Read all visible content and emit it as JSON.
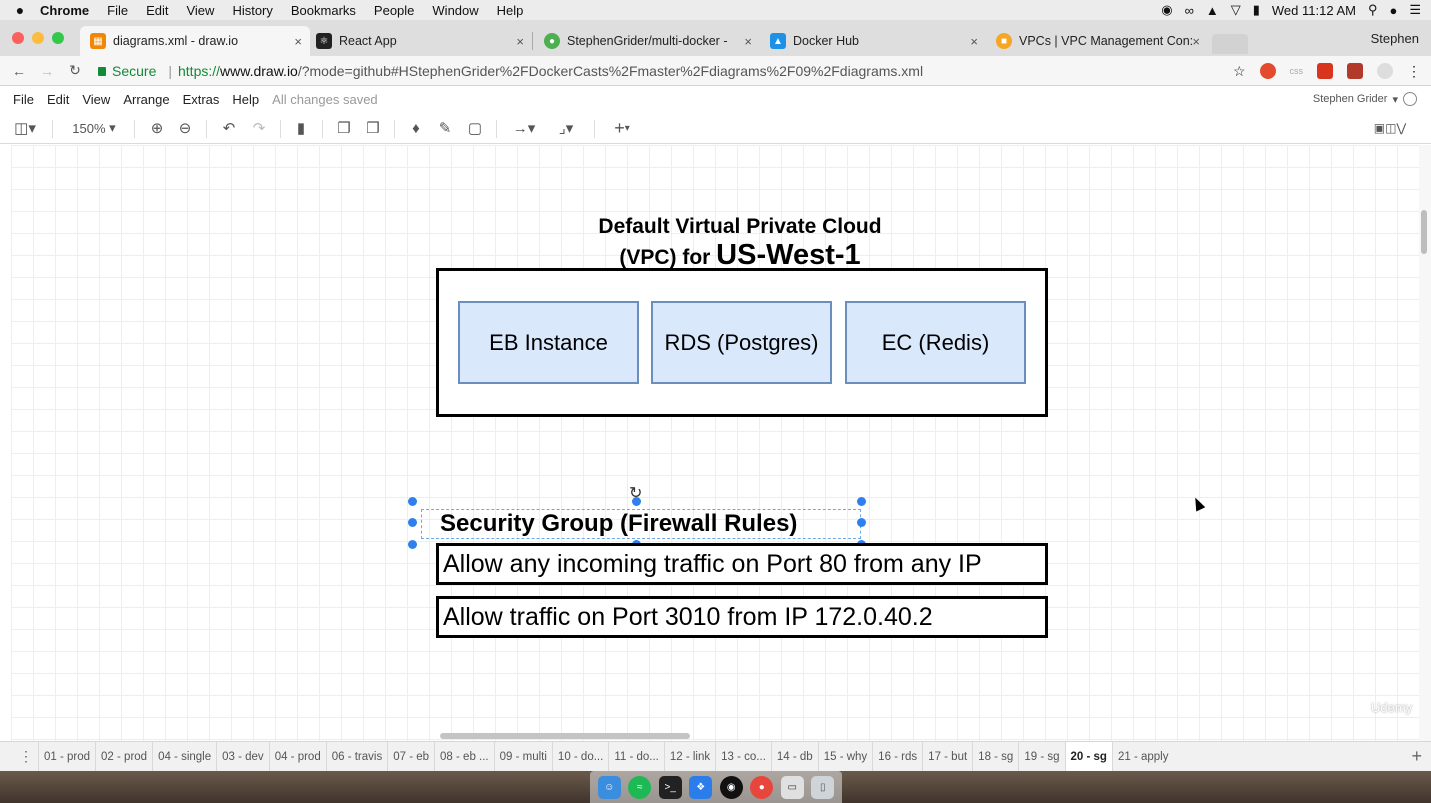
{
  "macos_menu": {
    "apple": "",
    "items": [
      "Chrome",
      "File",
      "Edit",
      "View",
      "History",
      "Bookmarks",
      "People",
      "Window",
      "Help"
    ],
    "clock": "Wed 11:12 AM"
  },
  "browser": {
    "tabs": [
      {
        "title": "diagrams.xml - draw.io",
        "active": true,
        "favicon_color": "#f08705"
      },
      {
        "title": "React App",
        "active": false,
        "favicon_color": "#222222"
      },
      {
        "title": "StephenGrider/multi-docker -",
        "active": false,
        "favicon_color": "#4caf50"
      },
      {
        "title": "Docker Hub",
        "active": false,
        "favicon_color": "#1d91e6"
      },
      {
        "title": "VPCs | VPC Management Con:",
        "active": false,
        "favicon_color": "#f5a623"
      }
    ],
    "profile": "Stephen",
    "address": {
      "secure_label": "Secure",
      "scheme": "https://",
      "host": "www.draw.io",
      "path": "/?mode=github#HStephenGrider%2FDockerCasts%2Fmaster%2Fdiagrams%2F09%2Fdiagrams.xml"
    },
    "extension_label": "css"
  },
  "drawio": {
    "menu": [
      "File",
      "Edit",
      "View",
      "Arrange",
      "Extras",
      "Help"
    ],
    "save_status": "All changes saved",
    "user": "Stephen Grider",
    "zoom": "150%"
  },
  "diagram": {
    "vpc_title_line1": "Default Virtual Private Cloud",
    "vpc_title_line2_prefix": "(VPC) for",
    "vpc_title_region": "US-West-1",
    "services": [
      "EB Instance",
      "RDS (Postgres)",
      "EC (Redis)"
    ],
    "security_group_title": "Security Group (Firewall Rules)",
    "rules": [
      "Allow any incoming traffic on Port 80 from any IP",
      "Allow traffic on Port 3010 from IP 172.0.40.2"
    ],
    "fill_color": "#dae8fc",
    "stroke_color": "#6c8ebf",
    "selection_color": "#2f80ed"
  },
  "watermark": "Udemy",
  "pages": [
    {
      "label": "01 - prod",
      "active": false
    },
    {
      "label": "02 - prod",
      "active": false
    },
    {
      "label": "04 - single",
      "active": false
    },
    {
      "label": "03 - dev",
      "active": false
    },
    {
      "label": "04 - prod",
      "active": false
    },
    {
      "label": "06 - travis",
      "active": false
    },
    {
      "label": "07 - eb",
      "active": false
    },
    {
      "label": "08 - eb ...",
      "active": false
    },
    {
      "label": "09 - multi",
      "active": false
    },
    {
      "label": "10 - do...",
      "active": false
    },
    {
      "label": "11 - do...",
      "active": false
    },
    {
      "label": "12 - link",
      "active": false
    },
    {
      "label": "13 - co...",
      "active": false
    },
    {
      "label": "14 - db",
      "active": false
    },
    {
      "label": "15 - why",
      "active": false
    },
    {
      "label": "16 - rds",
      "active": false
    },
    {
      "label": "17 - but",
      "active": false
    },
    {
      "label": "18 - sg",
      "active": false
    },
    {
      "label": "19 - sg",
      "active": false
    },
    {
      "label": "20 - sg",
      "active": true
    },
    {
      "label": "21 - apply",
      "active": false
    }
  ]
}
